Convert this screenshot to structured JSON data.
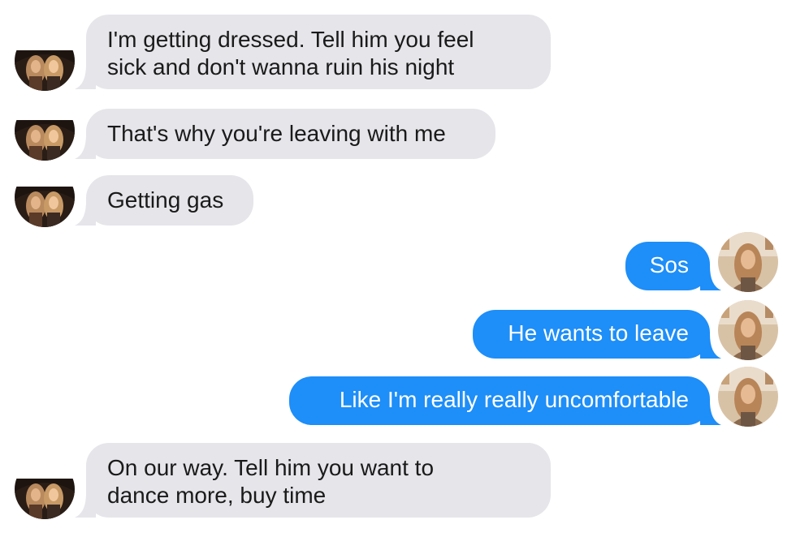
{
  "conversation": {
    "messages": [
      {
        "sender": "contact",
        "text_lines": [
          "I'm getting dressed. Tell him you feel",
          "sick and don't wanna ruin his night"
        ]
      },
      {
        "sender": "contact",
        "text_lines": [
          "That's why you're leaving with me"
        ]
      },
      {
        "sender": "contact",
        "text_lines": [
          "Getting gas"
        ]
      },
      {
        "sender": "me",
        "text_lines": [
          "Sos"
        ]
      },
      {
        "sender": "me",
        "text_lines": [
          "He wants to leave"
        ]
      },
      {
        "sender": "me",
        "text_lines": [
          "Like I'm really really uncomfortable"
        ]
      },
      {
        "sender": "contact",
        "text_lines": [
          "On our way. Tell him you want to",
          "dance more, buy time"
        ]
      }
    ]
  },
  "colors": {
    "incoming_bubble": "#e5e5ea",
    "outgoing_bubble": "#1e8ef8",
    "incoming_text": "#1a1a1a",
    "outgoing_text": "#ffffff"
  },
  "icons": {
    "contact_avatar": "group-photo-avatar",
    "my_avatar": "profile-photo-avatar"
  }
}
